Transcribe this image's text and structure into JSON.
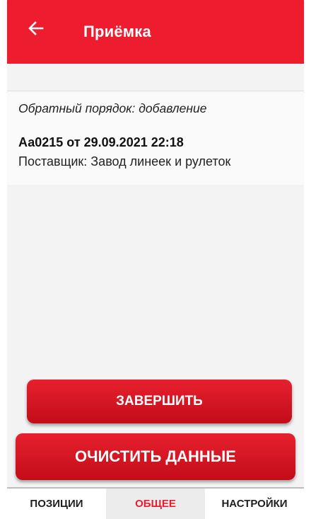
{
  "appbar": {
    "title": "Приёмка",
    "back_icon": "arrow-left-icon"
  },
  "document": {
    "order_text": "Обратный порядок: добавление",
    "number_date": "Аа0215 от 29.09.2021 22:18",
    "supplier": "Поставщик: Завод линеек и рулеток"
  },
  "actions": {
    "finish_label": "ЗАВЕРШИТЬ",
    "clear_label": "ОЧИСТИТЬ ДАННЫЕ"
  },
  "tabs": [
    {
      "label": "ПОЗИЦИИ",
      "active": false
    },
    {
      "label": "ОБЩЕЕ",
      "active": true
    },
    {
      "label": "НАСТРОЙКИ",
      "active": false
    }
  ],
  "colors": {
    "accent": "#ed1c2e",
    "background": "#f3f3f3"
  }
}
